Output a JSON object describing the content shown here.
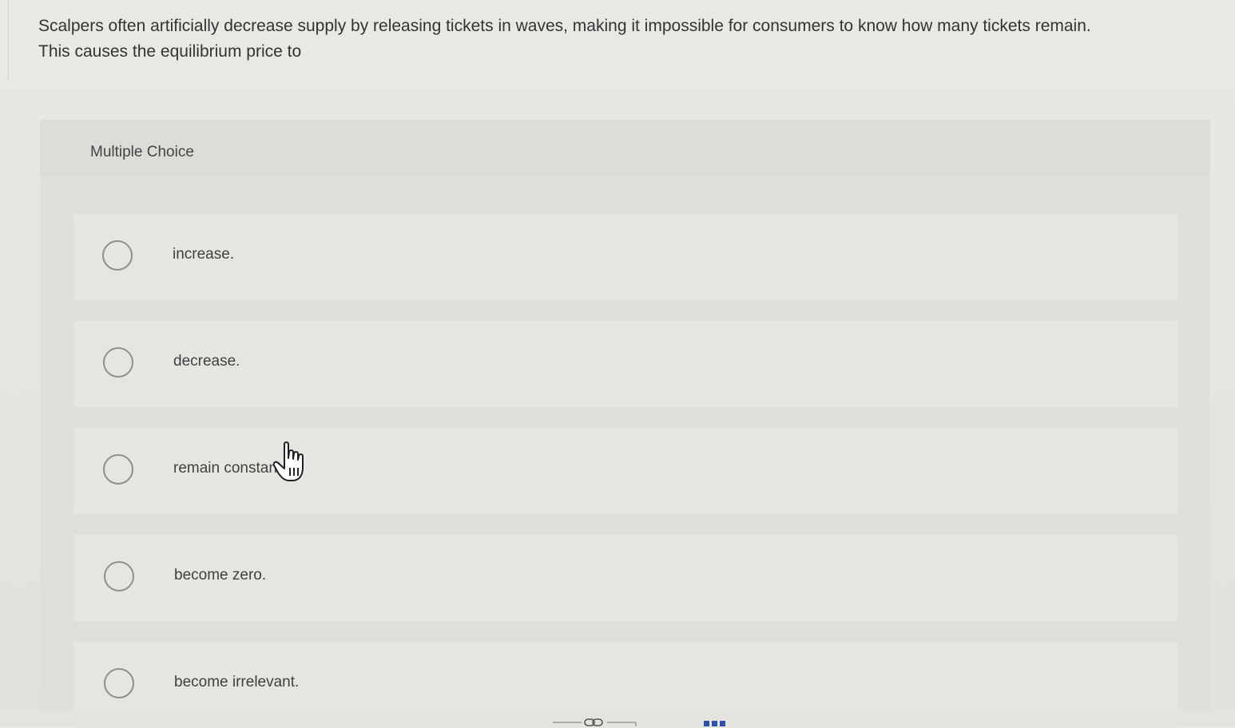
{
  "question": {
    "line1": "Scalpers often artificially decrease supply by releasing tickets in waves, making it impossible for consumers to know how many tickets remain.",
    "line2": "This causes the equilibrium price to"
  },
  "multiple_choice": {
    "title": "Multiple Choice",
    "options": [
      {
        "label": "increase.",
        "selected": false
      },
      {
        "label": "decrease.",
        "selected": false
      },
      {
        "label": "remain constant.",
        "selected": false
      },
      {
        "label": "become zero.",
        "selected": false
      },
      {
        "label": "become irrelevant.",
        "selected": false
      }
    ]
  },
  "icons": {
    "cursor": "hand-pointer-icon",
    "toolbar_link": "link-icon",
    "toolbar_more": "more-dots-icon"
  },
  "colors": {
    "background": "#e7e6e2",
    "panel": "#e0dfdb",
    "radio_border": "#8e8e8e",
    "toolbar_accent": "#2b4fb5"
  }
}
